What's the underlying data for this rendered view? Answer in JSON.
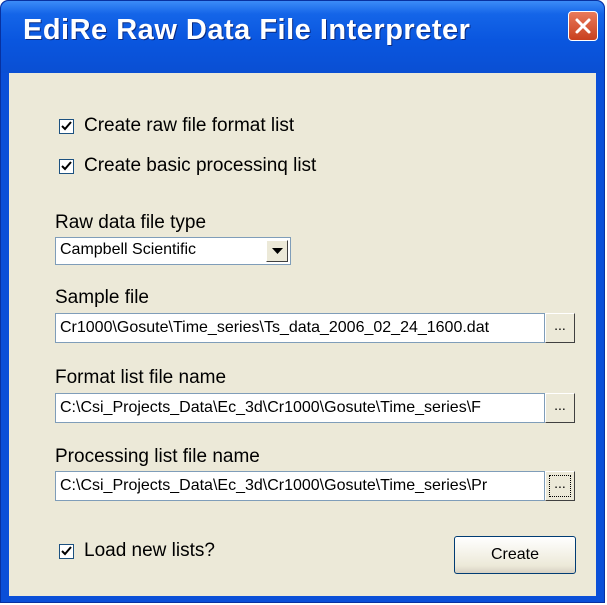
{
  "window": {
    "title": "EdiRe Raw Data File Interpreter"
  },
  "options": {
    "create_format_list": {
      "label": "Create raw file format list",
      "checked": true
    },
    "create_processing_list": {
      "label": "Create basic processinq list",
      "checked": true
    },
    "load_new_lists": {
      "label": "Load new lists?",
      "checked": true
    }
  },
  "raw_type": {
    "label": "Raw data file type",
    "selected": "Campbell Scientific"
  },
  "sample_file": {
    "label": "Sample file",
    "value": "Cr1000\\Gosute\\Time_series\\Ts_data_2006_02_24_1600.dat",
    "browse_label": "..."
  },
  "format_list": {
    "label": "Format list file name",
    "value": "C:\\Csi_Projects_Data\\Ec_3d\\Cr1000\\Gosute\\Time_series\\F",
    "browse_label": "..."
  },
  "processing_list": {
    "label": "Processing list file name",
    "value": "C:\\Csi_Projects_Data\\Ec_3d\\Cr1000\\Gosute\\Time_series\\Pr",
    "browse_label": "..."
  },
  "buttons": {
    "create": "Create"
  },
  "icons": {
    "close": "close-icon",
    "checkmark": "check-icon",
    "dropdown": "chevron-down-icon"
  },
  "colors": {
    "titlebar": "#0a56df",
    "client": "#ece9d8",
    "close": "#c8401f"
  }
}
